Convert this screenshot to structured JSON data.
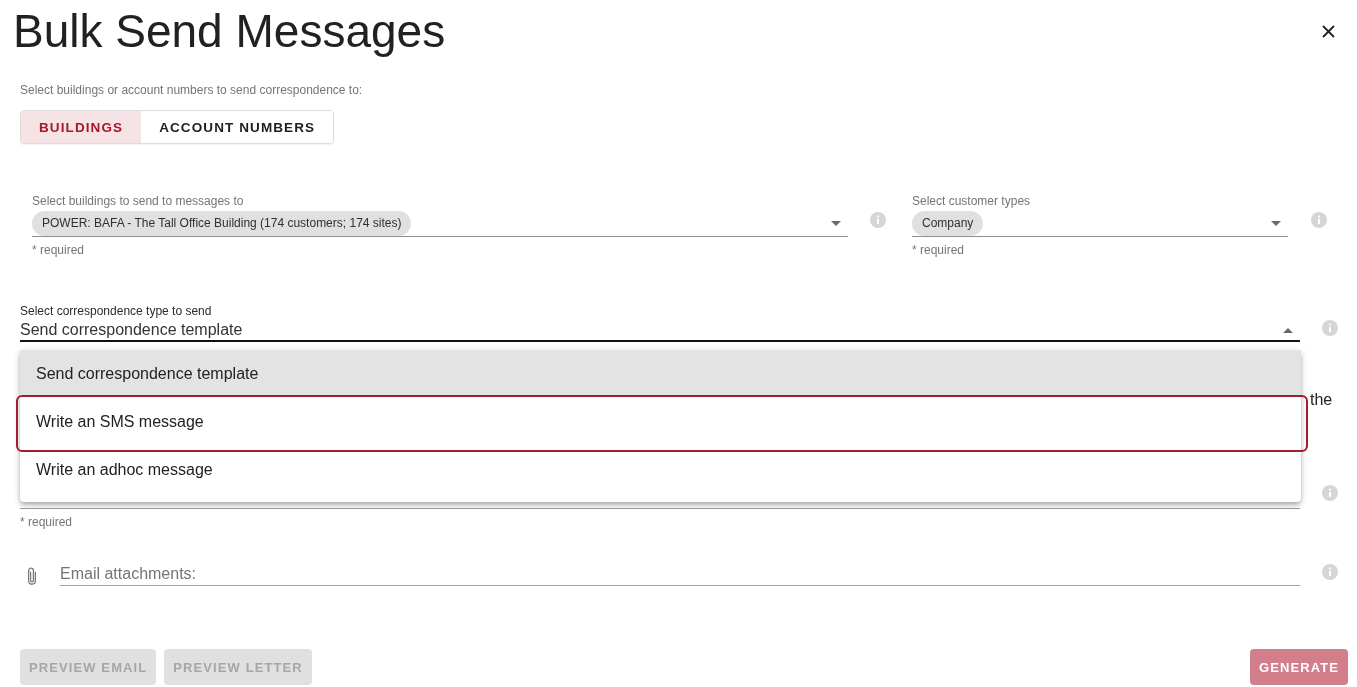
{
  "title": "Bulk Send Messages",
  "recipient_mode": {
    "label": "Select buildings or account numbers to send correspondence to:",
    "options": [
      {
        "label": "BUILDINGS",
        "selected": true
      },
      {
        "label": "ACCOUNT NUMBERS",
        "selected": false
      }
    ]
  },
  "filters": [
    {
      "label": "Select buildings to send to messages to",
      "chips": [
        "POWER: BAFA - The Tall Office Building (174 customers; 174 sites)"
      ],
      "expanded": false,
      "helper": "* required"
    },
    {
      "label": "Select customer types",
      "chips": [
        "Company"
      ],
      "expanded": false,
      "helper": "* required"
    }
  ],
  "correspondence_type": {
    "label": "Select correspondence type to send",
    "value": "Send correspondence template",
    "expanded": true,
    "options": [
      {
        "label": "Send correspondence template",
        "selected": true,
        "highlighted": false
      },
      {
        "label": "Write an SMS message",
        "selected": false,
        "highlighted": true
      },
      {
        "label": "Write an adhoc message",
        "selected": false,
        "highlighted": false
      }
    ]
  },
  "partially_hidden_text": "the",
  "hidden_field": {
    "helper": "* required"
  },
  "attachments": {
    "placeholder": "Email attachments:"
  },
  "buttons": [
    {
      "label": "PREVIEW EMAIL",
      "kind": "secondary",
      "disabled": true
    },
    {
      "label": "PREVIEW LETTER",
      "kind": "secondary",
      "disabled": true
    },
    {
      "label": "GENERATE",
      "kind": "primary",
      "disabled": true
    }
  ]
}
